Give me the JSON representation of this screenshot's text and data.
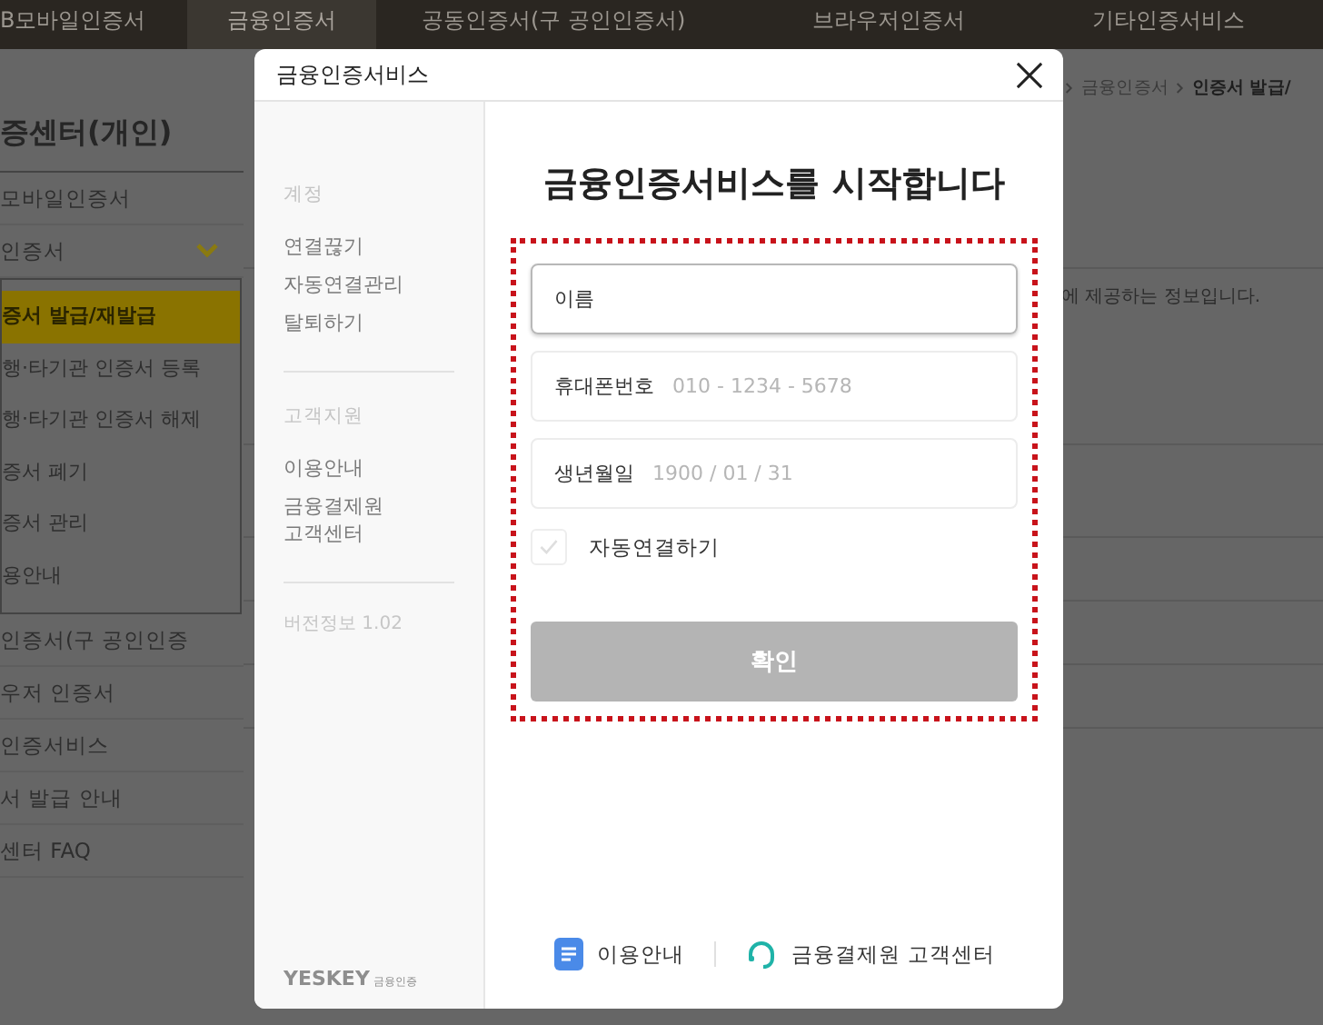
{
  "nav": {
    "tabs": [
      {
        "label": "B모바일인증서",
        "selected": false
      },
      {
        "label": "금융인증서",
        "selected": true
      },
      {
        "label": "공동인증서(구 공인인증서)",
        "selected": false
      },
      {
        "label": "브라우저인증서",
        "selected": false
      },
      {
        "label": "기타인증서비스",
        "selected": false
      }
    ]
  },
  "sidebar": {
    "title": "증센터(개인)",
    "items": [
      {
        "label": "모바일인증서"
      },
      {
        "label": "인증서",
        "expanded": true,
        "children": [
          {
            "label": "증서 발급/재발급",
            "selected": true
          },
          {
            "label": "행·타기관 인증서 등록",
            "selected": false
          },
          {
            "label": "행·타기관 인증서 해제",
            "selected": false
          },
          {
            "label": "증서 폐기",
            "selected": false
          },
          {
            "label": "증서 관리",
            "selected": false
          },
          {
            "label": "용안내",
            "selected": false
          }
        ]
      },
      {
        "label": "인증서(구 공인인증"
      },
      {
        "label": "우저 인증서"
      },
      {
        "label": "인증서비스"
      },
      {
        "label": "서 발급 안내"
      },
      {
        "label": "센터 FAQ"
      }
    ]
  },
  "breadcrumb": [
    "금융인증서",
    "인증서 발급/"
  ],
  "notice": "에 제공하는 정보입니다.",
  "dialog": {
    "title": "금융인증서비스",
    "menu": [
      {
        "heading": "계정",
        "items": [
          "연결끊기",
          "자동연결관리",
          "탈퇴하기"
        ]
      },
      {
        "heading": "고객지원",
        "items": [
          "이용안내",
          "금융결제원 고객센터"
        ]
      }
    ],
    "version": "버전정보 1.02",
    "logo": "YESKEY",
    "logo_caption": "금융인증",
    "heading": "금융인증서비스를 시작합니다",
    "fields": [
      {
        "label": "이름",
        "focused": true
      },
      {
        "label": "휴대폰번호",
        "placeholder": "010 - 1234 - 5678",
        "focused": false
      },
      {
        "label": "생년월일",
        "placeholder": "1900 / 01 / 31",
        "focused": false
      }
    ],
    "auto_connect": {
      "label": "자동연결하기",
      "checked": false
    },
    "submit": {
      "label": "확인",
      "disabled": true
    },
    "footer_links": [
      {
        "kind": "guide",
        "label": "이용안내"
      },
      {
        "kind": "support",
        "label": "금융결제원 고객센터"
      }
    ]
  }
}
